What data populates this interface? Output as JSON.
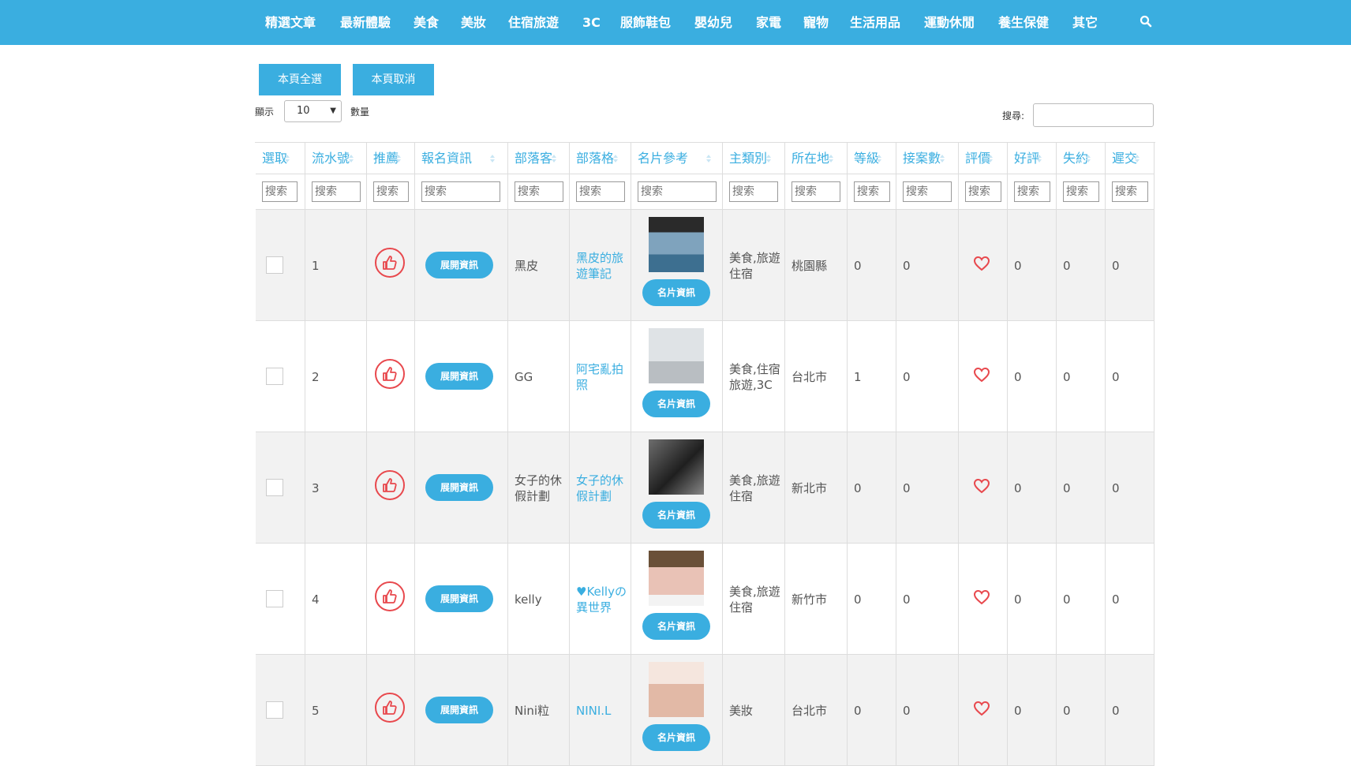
{
  "nav": {
    "items": [
      "精選文章",
      "最新體驗",
      "美食",
      "美妝",
      "住宿旅遊",
      "3C",
      "服飾鞋包",
      "嬰幼兒",
      "家電",
      "寵物",
      "生活用品",
      "運動休閒",
      "養生保健",
      "其它"
    ],
    "search_icon": "search-icon"
  },
  "toolbar": {
    "select_all": "本頁全選",
    "deselect_all": "本頁取消",
    "show_label": "顯示",
    "page_size": "10",
    "count_label": "數量",
    "search_label": "搜尋:",
    "search_value": ""
  },
  "table": {
    "columns": [
      "選取",
      "流水號",
      "推薦",
      "報名資訊",
      "部落客",
      "部落格",
      "名片參考",
      "主類別",
      "所在地",
      "等級",
      "接案數",
      "評價",
      "好評",
      "失約",
      "遲交"
    ],
    "filter_placeholder": "搜索",
    "expand_label": "展開資訊",
    "card_label": "名片資訊",
    "rows": [
      {
        "serial": "1",
        "blogger": "黑皮",
        "blog": "黑皮的旅遊筆記",
        "category": "美食,旅遊住宿",
        "location": "桃園縣",
        "level": "0",
        "cases": "0",
        "good": "0",
        "missed": "0",
        "late": "0"
      },
      {
        "serial": "2",
        "blogger": "GG",
        "blog": "阿宅亂拍照",
        "category": "美食,住宿旅遊,3C",
        "location": "台北市",
        "level": "1",
        "cases": "0",
        "good": "0",
        "missed": "0",
        "late": "0"
      },
      {
        "serial": "3",
        "blogger": "女子的休假計劃",
        "blog": "女子的休假計劃",
        "category": "美食,旅遊住宿",
        "location": "新北市",
        "level": "0",
        "cases": "0",
        "good": "0",
        "missed": "0",
        "late": "0"
      },
      {
        "serial": "4",
        "blogger": "kelly",
        "blog": "♥Kellyの異世界",
        "category": "美食,旅遊住宿",
        "location": "新竹市",
        "level": "0",
        "cases": "0",
        "good": "0",
        "missed": "0",
        "late": "0"
      },
      {
        "serial": "5",
        "blogger": "Nini粒",
        "blog": "NINI.L",
        "category": "美妝",
        "location": "台北市",
        "level": "0",
        "cases": "0",
        "good": "0",
        "missed": "0",
        "late": "0"
      }
    ]
  },
  "colors": {
    "accent": "#3aaee0",
    "heart": "#e8484d",
    "stripe": "#f2f2f2"
  }
}
